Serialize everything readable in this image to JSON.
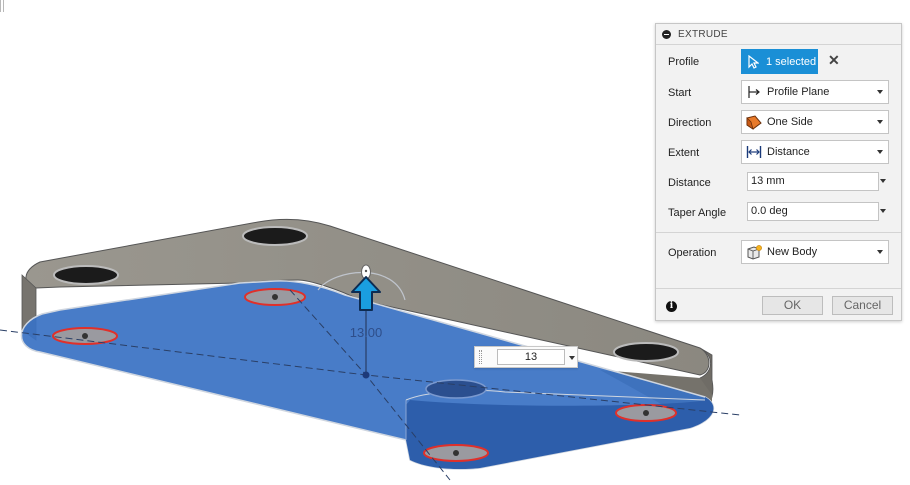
{
  "viewport": {
    "dimension_label": "13.00",
    "manipulator_value": "13"
  },
  "panel": {
    "title": "EXTRUDE",
    "profile": {
      "label": "Profile",
      "value": "1 selected"
    },
    "start": {
      "label": "Start",
      "value": "Profile Plane"
    },
    "direction": {
      "label": "Direction",
      "value": "One Side"
    },
    "extent": {
      "label": "Extent",
      "value": "Distance"
    },
    "distance": {
      "label": "Distance",
      "value": "13 mm"
    },
    "taper": {
      "label": "Taper Angle",
      "value": "0.0 deg"
    },
    "operation": {
      "label": "Operation",
      "value": "New Body"
    },
    "ok_label": "OK",
    "cancel_label": "Cancel"
  },
  "colors": {
    "selection_blue": "#1a8fd6",
    "profile_fill": "#3a72c4",
    "body_gray": "#8a8780",
    "hole_outline": "#e0302a"
  },
  "icons": {
    "profile": "cursor-arrow-icon",
    "start": "profile-plane-icon",
    "direction": "one-side-icon",
    "extent": "distance-icon",
    "operation": "new-body-icon",
    "collapse": "collapse-icon",
    "info": "info-icon",
    "clear": "close-icon",
    "manipulator": "distance-arrow-icon"
  }
}
